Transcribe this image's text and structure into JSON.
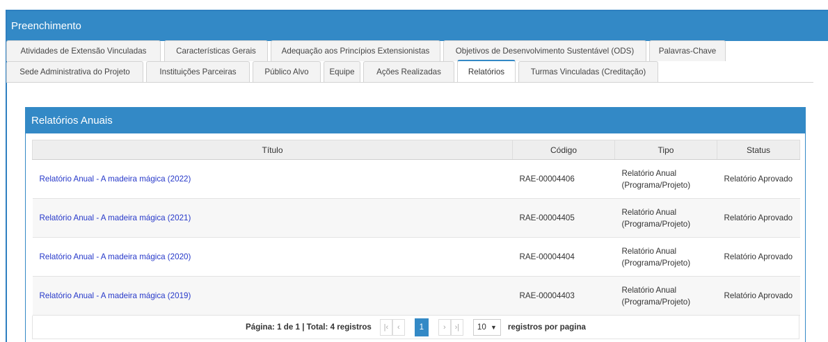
{
  "header": {
    "title": "Preenchimento"
  },
  "tabs_row1": [
    {
      "label": "Atividades de Extensão Vinculadas",
      "active": false
    },
    {
      "label": "Características Gerais",
      "active": false
    },
    {
      "label": "Adequação aos Princípios Extensionistas",
      "active": false
    },
    {
      "label": "Objetivos de Desenvolvimento Sustentável (ODS)",
      "active": false
    },
    {
      "label": "Palavras-Chave",
      "active": false
    }
  ],
  "tabs_row2": [
    {
      "label": "Sede Administrativa do Projeto",
      "active": false
    },
    {
      "label": "Instituições Parceiras",
      "active": false
    },
    {
      "label": "Público Alvo",
      "active": false
    },
    {
      "label": "Equipe",
      "active": false
    },
    {
      "label": "Ações Realizadas",
      "active": false
    },
    {
      "label": "Relatórios",
      "active": true
    },
    {
      "label": "Turmas Vinculadas (Creditação)",
      "active": false
    }
  ],
  "panel": {
    "title": "Relatórios Anuais",
    "columns": [
      "Título",
      "Código",
      "Tipo",
      "Status"
    ],
    "rows": [
      {
        "titulo": "Relatório Anual - A madeira mágica (2022)",
        "codigo": "RAE-00004406",
        "tipo1": "Relatório Anual",
        "tipo2": "(Programa/Projeto)",
        "status": "Relatório Aprovado"
      },
      {
        "titulo": "Relatório Anual - A madeira mágica (2021)",
        "codigo": "RAE-00004405",
        "tipo1": "Relatório Anual",
        "tipo2": "(Programa/Projeto)",
        "status": "Relatório Aprovado"
      },
      {
        "titulo": "Relatório Anual - A madeira mágica (2020)",
        "codigo": "RAE-00004404",
        "tipo1": "Relatório Anual",
        "tipo2": "(Programa/Projeto)",
        "status": "Relatório Aprovado"
      },
      {
        "titulo": "Relatório Anual - A madeira mágica (2019)",
        "codigo": "RAE-00004403",
        "tipo1": "Relatório Anual",
        "tipo2": "(Programa/Projeto)",
        "status": "Relatório Aprovado"
      }
    ]
  },
  "pager": {
    "info": "Página: 1 de 1 | Total: 4 registros",
    "current_page": "1",
    "page_size": "10",
    "per_page_label": "registros por pagina",
    "icons": [
      "first-page-icon",
      "prev-page-icon",
      "next-page-icon",
      "last-page-icon",
      "chevron-down-icon"
    ]
  },
  "colors": {
    "accent": "#3389c6",
    "link": "#2638c9"
  }
}
